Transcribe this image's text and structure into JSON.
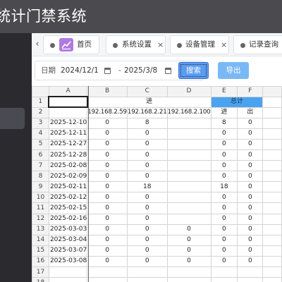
{
  "app": {
    "title": "统计门禁系统"
  },
  "tabs": [
    {
      "label": "首页",
      "icon": "chart-icon"
    },
    {
      "label": "系统设置",
      "close": "×"
    },
    {
      "label": "设备管理",
      "close": "×"
    },
    {
      "label": "记录查询"
    }
  ],
  "nav": {
    "prev": "‹"
  },
  "filter": {
    "date_label": "日期",
    "start_date": "2024/12/1",
    "separator": "-",
    "end_date": "2025/3/8",
    "search_label": "搜索",
    "export_label": "导出"
  },
  "sheet": {
    "col_letters": [
      "A",
      "B",
      "C",
      "D",
      "E",
      "F"
    ],
    "row_numbers": [
      "1",
      "2",
      "3",
      "4",
      "5",
      "6",
      "7",
      "8",
      "9",
      "10",
      "11",
      "12",
      "13",
      "14",
      "15",
      "16",
      "17",
      "18"
    ],
    "group_in": "进",
    "group_total": "总计",
    "ip_headers": [
      "192.168.2.59",
      "192.168.2.21",
      "192.168.2.100"
    ],
    "total_in": "进",
    "total_out": "出",
    "rows": [
      [
        "2025-12-10",
        "0",
        "8",
        "",
        "8",
        "0"
      ],
      [
        "2025-12-11",
        "0",
        "0",
        "",
        "0",
        "0"
      ],
      [
        "2025-12-27",
        "0",
        "0",
        "",
        "0",
        "0"
      ],
      [
        "2025-12-28",
        "0",
        "0",
        "",
        "0",
        "0"
      ],
      [
        "2025-02-08",
        "0",
        "0",
        "",
        "0",
        "0"
      ],
      [
        "2025-02-09",
        "0",
        "0",
        "",
        "0",
        "0"
      ],
      [
        "2025-02-11",
        "0",
        "18",
        "",
        "18",
        "0"
      ],
      [
        "2025-02-12",
        "0",
        "0",
        "",
        "0",
        "0"
      ],
      [
        "2025-02-15",
        "0",
        "0",
        "",
        "0",
        "0"
      ],
      [
        "2025-02-16",
        "0",
        "0",
        "",
        "0",
        "0"
      ],
      [
        "2025-03-03",
        "0",
        "0",
        "0",
        "0",
        "0"
      ],
      [
        "2025-03-04",
        "0",
        "0",
        "0",
        "0",
        "0"
      ],
      [
        "2025-03-07",
        "0",
        "0",
        "0",
        "0",
        "0"
      ],
      [
        "2025-03-08",
        "0",
        "0",
        "0",
        "0",
        "0"
      ]
    ]
  },
  "colors": {
    "header": "#4a4a4f",
    "sidebar": "#2b2b2f",
    "accent": "#5b9cf2",
    "total_fill": "#4aa3f0",
    "selected_col": "#f6d896"
  }
}
